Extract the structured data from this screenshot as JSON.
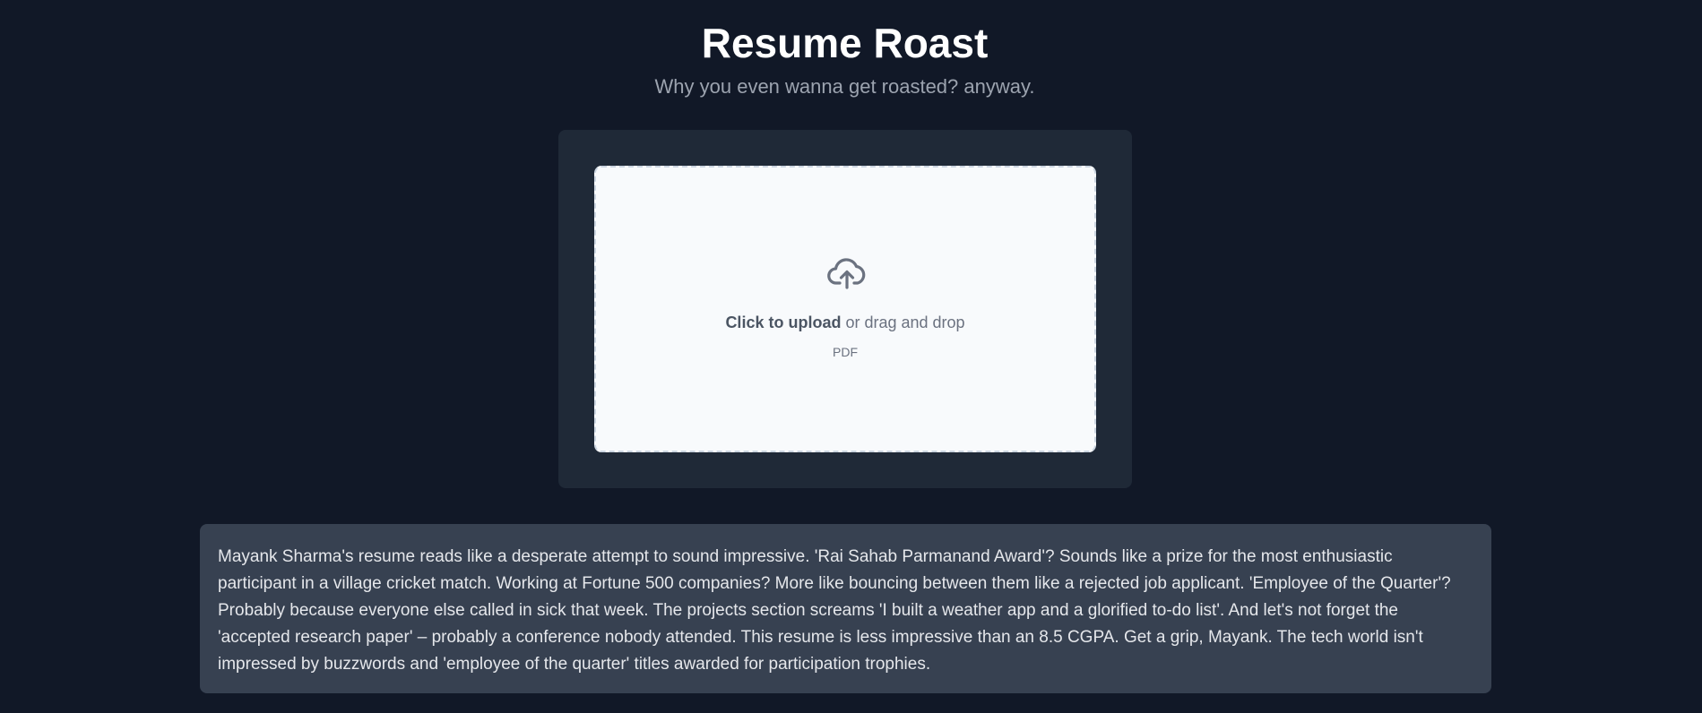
{
  "header": {
    "title": "Resume Roast",
    "subtitle": "Why you even wanna get roasted? anyway."
  },
  "upload": {
    "icon": "cloud-upload-icon",
    "click_label": "Click to upload",
    "drag_label": " or drag and drop",
    "file_type": "PDF"
  },
  "roast": {
    "text": "Mayank Sharma's resume reads like a desperate attempt to sound impressive. 'Rai Sahab Parmanand Award'? Sounds like a prize for the most enthusiastic participant in a village cricket match. Working at Fortune 500 companies? More like bouncing between them like a rejected job applicant. 'Employee of the Quarter'? Probably because everyone else called in sick that week. The projects section screams 'I built a weather app and a glorified to-do list'. And let's not forget the 'accepted research paper' – probably a conference nobody attended. This resume is less impressive than an 8.5 CGPA. Get a grip, Mayank. The tech world isn't impressed by buzzwords and 'employee of the quarter' titles awarded for participation trophies."
  },
  "colors": {
    "background": "#111827",
    "card": "#1f2937",
    "dropzone": "#f8fafc",
    "roast_box": "#374151",
    "text_muted": "#9ca3af"
  }
}
